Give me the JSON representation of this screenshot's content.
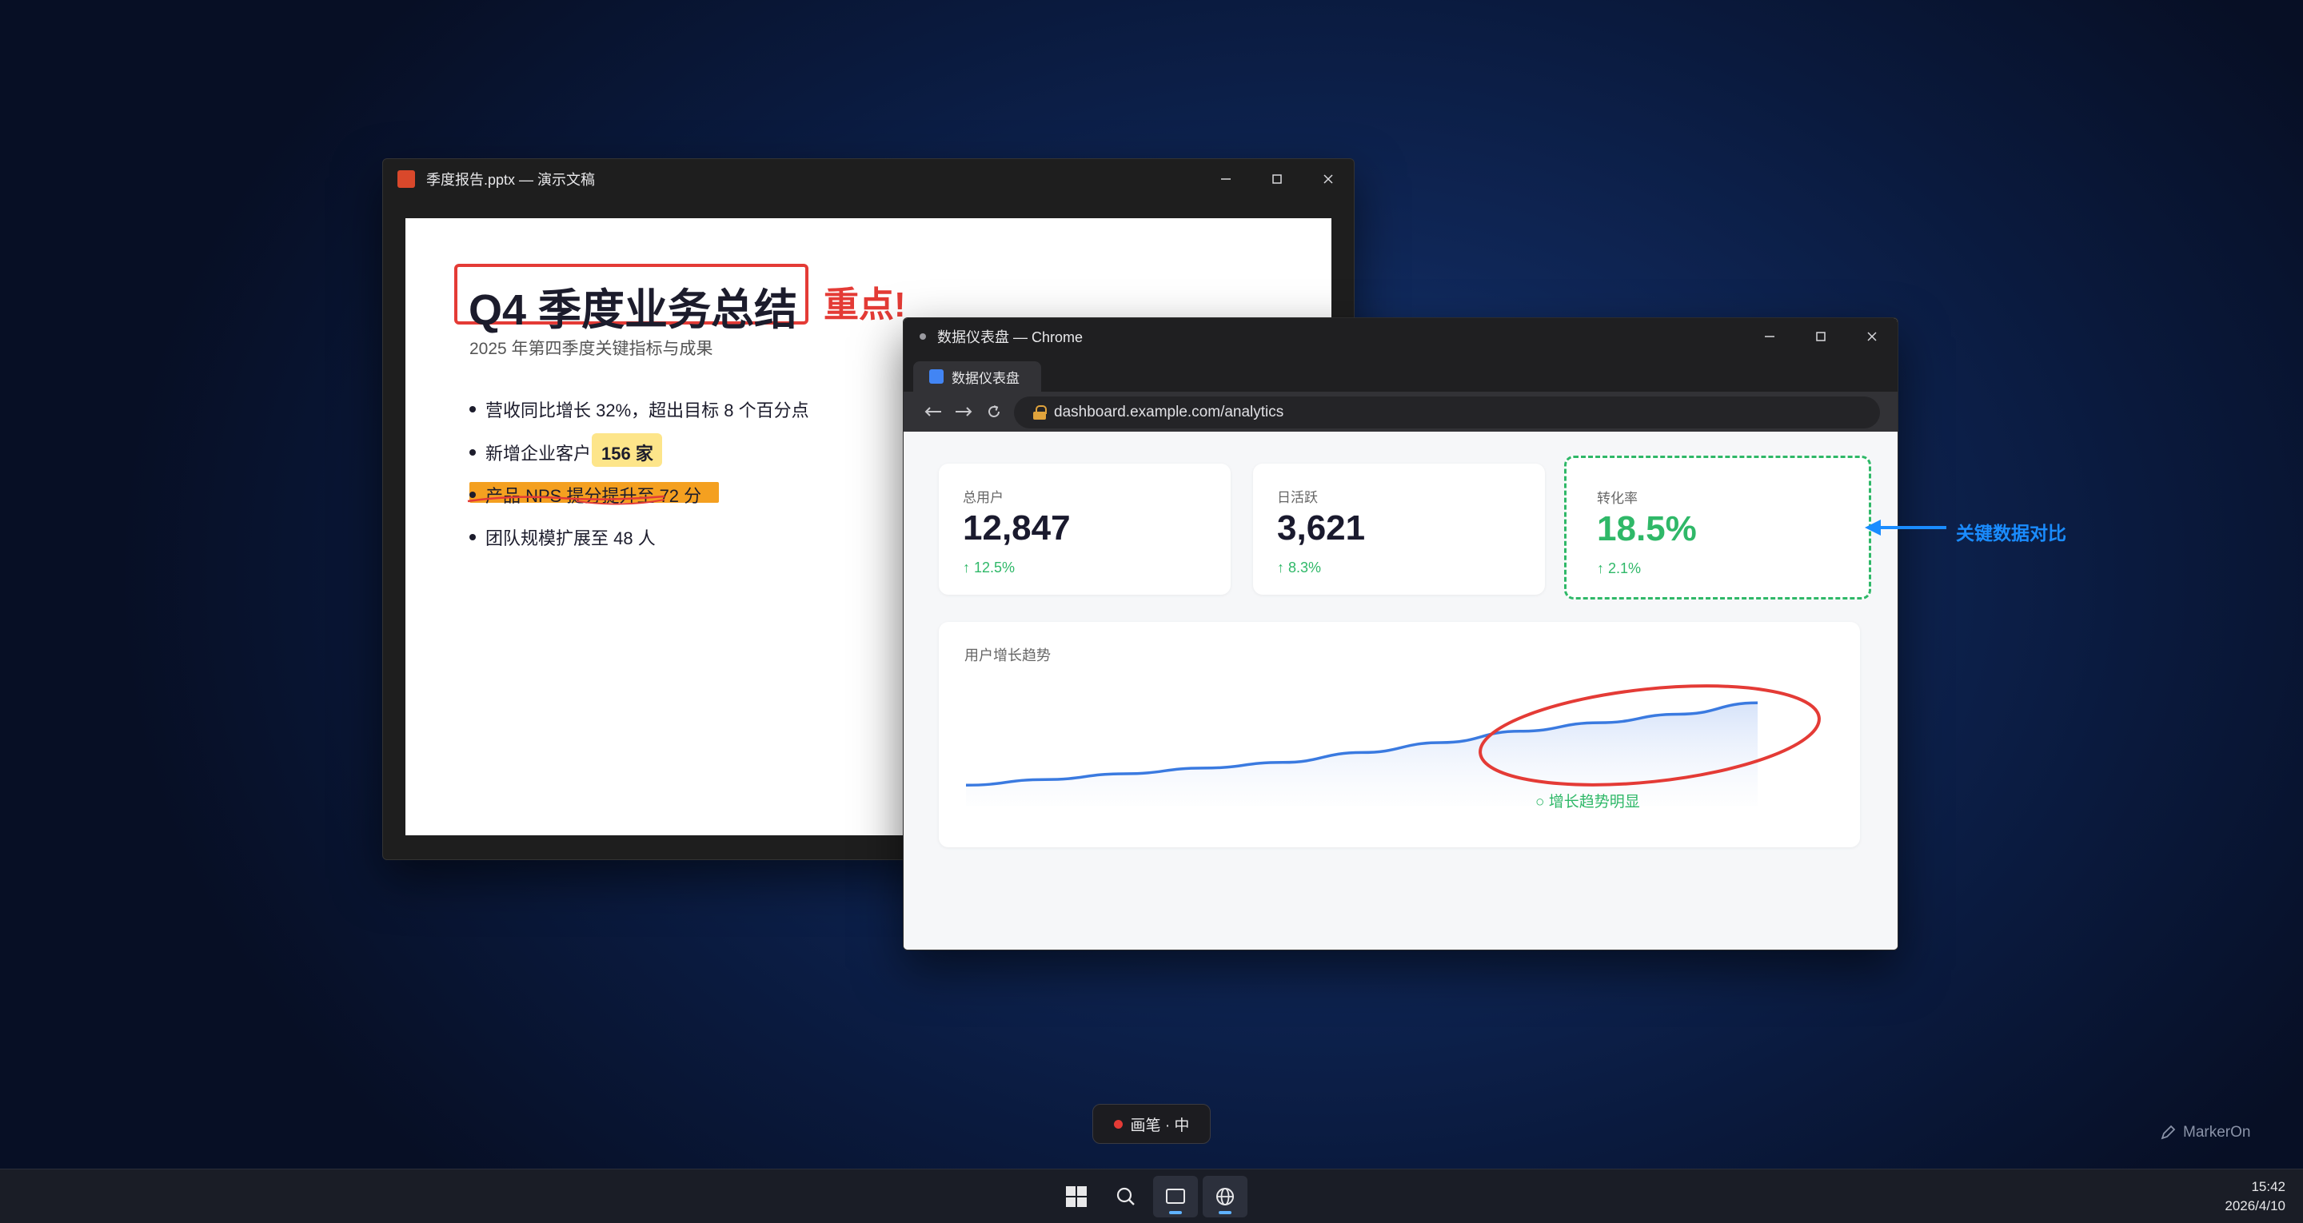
{
  "ppt": {
    "title": "季度报告.pptx — 演示文稿",
    "slide": {
      "title": "Q4 季度业务总结",
      "emphasis": "重点!",
      "subtitle": "2025 年第四季度关键指标与成果",
      "bullet1": "营收同比增长 32%，超出目标 8 个百分点",
      "bullet2": "新增企业客户",
      "bullet2_highlight": "156 家",
      "bullet3": "产品 NPS 提分提升至 72 分",
      "bullet4": "团队规模扩展至 48 人"
    }
  },
  "chrome": {
    "title": "数据仪表盘 — Chrome",
    "tab_label": "数据仪表盘",
    "url": "dashboard.example.com/analytics",
    "cards": [
      {
        "label": "总用户",
        "value": "12,847",
        "delta": "↑ 12.5%"
      },
      {
        "label": "日活跃",
        "value": "3,621",
        "delta": "↑ 8.3%"
      },
      {
        "label": "转化率",
        "value": "18.5%",
        "delta": "↑ 2.1%"
      }
    ],
    "chart": {
      "title": "用户增长趋势",
      "annotation": "○ 增长趋势明显"
    }
  },
  "chart_data": {
    "type": "area",
    "title": "用户增长趋势",
    "x": [
      0,
      1,
      2,
      3,
      4,
      5,
      6,
      7,
      8,
      9,
      10
    ],
    "values": [
      10,
      14,
      18,
      22,
      26,
      33,
      40,
      48,
      54,
      60,
      68
    ],
    "ylim": [
      0,
      80
    ],
    "grid": false,
    "color": "#3a7ae0"
  },
  "annotations": {
    "arrow_label": "关键数据对比",
    "arrow_color": "#1a8cff",
    "circle_color": "#e43b36"
  },
  "pen_tool": {
    "label": "画笔 · 中"
  },
  "watermark": "MarkerOn",
  "taskbar": {
    "time": "15:42",
    "date": "2026/4/10"
  }
}
